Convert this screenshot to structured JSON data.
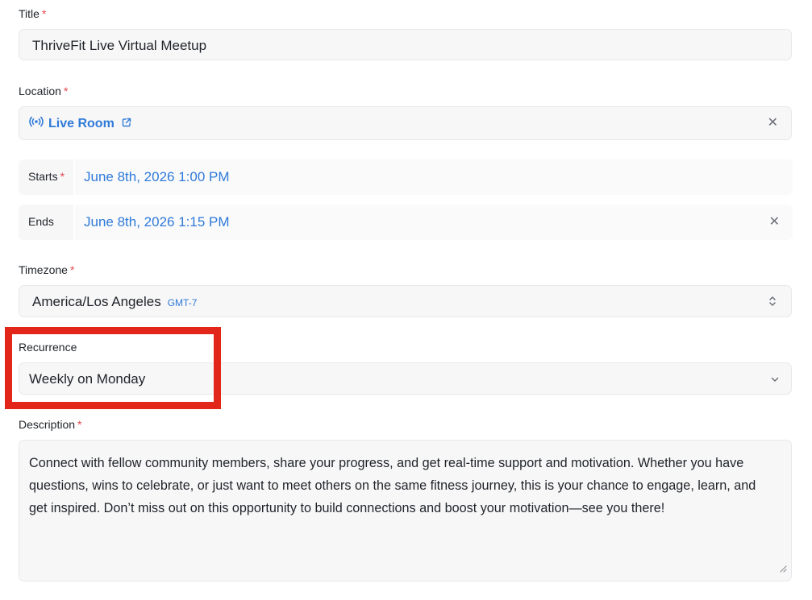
{
  "title": {
    "label": "Title",
    "required": "*",
    "value": "ThriveFit Live Virtual Meetup"
  },
  "location": {
    "label": "Location",
    "required": "*",
    "value": "Live Room",
    "clear": "✕",
    "icon": "broadcast-icon"
  },
  "starts": {
    "label": "Starts",
    "required": "*",
    "value": "June 8th, 2026 1:00 PM"
  },
  "ends": {
    "label": "Ends",
    "value": "June 8th, 2026 1:15 PM",
    "clear": "✕"
  },
  "timezone": {
    "label": "Timezone",
    "required": "*",
    "value": "America/Los Angeles",
    "offset": "GMT-7"
  },
  "recurrence": {
    "label": "Recurrence",
    "value": "Weekly on Monday"
  },
  "description": {
    "label": "Description",
    "required": "*",
    "value": "Connect with fellow community members, share your progress, and get real-time support and motivation. Whether you have questions, wins to celebrate, or just want to meet others on the same fitness journey, this is your chance to engage, learn, and get inspired. Don’t miss out on this opportunity to build connections and boost your motivation—see you there!"
  },
  "colors": {
    "accent": "#2f7ad8",
    "required": "#e5484d",
    "highlight": "#e2261a"
  }
}
